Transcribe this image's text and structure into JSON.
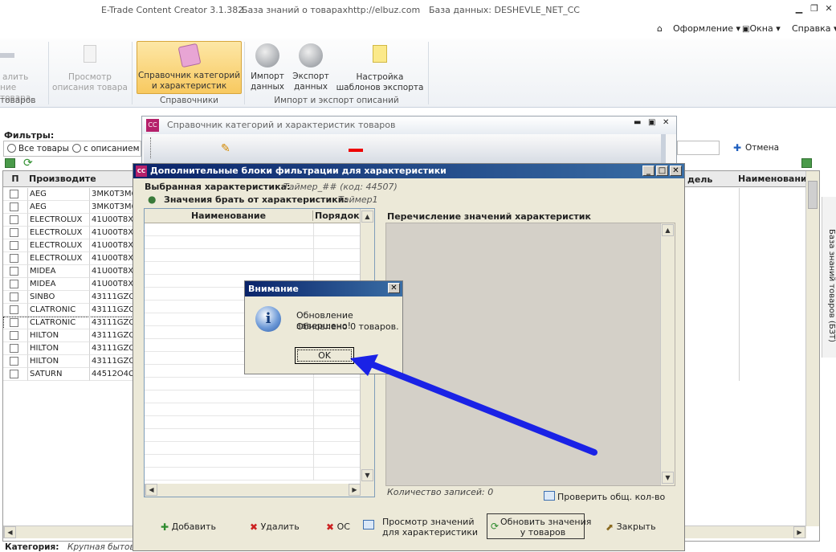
{
  "window": {
    "app_title": "E-Trade Content Creator 3.1.382",
    "kb_title": "База знаний о товарах",
    "site": "http://elbuz.com",
    "db_title": "База данных: DESHEVLE_NET_CC"
  },
  "menu": {
    "theme": "Оформление",
    "windows": "Окна",
    "help": "Справка"
  },
  "ribbon": {
    "partial_btn_line1": "алить",
    "partial_btn_line2": "ние товара",
    "partial_group": "товаров",
    "preview_line1": "Просмотр",
    "preview_line2": "описания товара",
    "categories_line1": "Справочник категорий",
    "categories_line2": "и характеристик",
    "group_refs": "Справочники",
    "import_line1": "Импорт",
    "import_line2": "данных",
    "export_line1": "Экспорт",
    "export_line2": "данных",
    "templates_line1": "Настройка",
    "templates_line2": "шаблонов экспорта",
    "group_io": "Импорт и экспорт описаний"
  },
  "main": {
    "filters_label": "Фильтры:",
    "radio_all": "Все товары",
    "radio_with_desc": "с описанием",
    "cancel_label": "Отмена",
    "col_p": "П",
    "col_maker": "Производите",
    "col_model_partial": "дель",
    "col_name": "Наименование",
    "side_tab": "База знаний товаров (БЗТ)",
    "category_label": "Категория:",
    "category_value": "Крупная бытов",
    "rows": [
      {
        "maker": "AEG",
        "code": "3МК0Т3М6"
      },
      {
        "maker": "AEG",
        "code": "3МК0Т3М6"
      },
      {
        "maker": "ELECTROLUX",
        "code": "41U00T8X"
      },
      {
        "maker": "ELECTROLUX",
        "code": "41U00T8X"
      },
      {
        "maker": "ELECTROLUX",
        "code": "41U00T8X"
      },
      {
        "maker": "ELECTROLUX",
        "code": "41U00T8X"
      },
      {
        "maker": "MIDEA",
        "code": "41U00T8X"
      },
      {
        "maker": "MIDEA",
        "code": "41U00T8X"
      },
      {
        "maker": "SINBO",
        "code": "43111GZQ"
      },
      {
        "maker": "CLATRONIC",
        "code": "43111GZQ"
      },
      {
        "maker": "CLATRONIC",
        "code": "43111GZQ"
      },
      {
        "maker": "HILTON",
        "code": "43111GZQ"
      },
      {
        "maker": "HILTON",
        "code": "43111GZQ"
      },
      {
        "maker": "HILTON",
        "code": "43111GZQ"
      },
      {
        "maker": "SATURN",
        "code": "44512O4C"
      }
    ]
  },
  "catwin": {
    "title": "Справочник категорий и характеристик товаров"
  },
  "filterwin": {
    "title": "Дополнительные блоки фильтрации для характеристики",
    "selected_label": "Выбранная характеристика:",
    "selected_value": "Таймер_## (код: 44507)",
    "source_label": "Значения брать от характеристики:",
    "source_value": "Таймер1",
    "col_name": "Наименование",
    "col_order": "Порядок",
    "enum_title": "Перечисление значений характеристик",
    "records": "Количество записей: 0",
    "check_total": "Проверить общ. кол-во",
    "btn_add": "Добавить",
    "btn_delete": "Удалить",
    "btn_os": "ОС",
    "btn_view_line1": "Просмотр значений",
    "btn_view_line2": "для характеристики",
    "btn_update_line1": "Обновить значения",
    "btn_update_line2": "у товаров",
    "btn_close": "Закрыть"
  },
  "dialog": {
    "title": "Внимание",
    "line1": "Обновление завершено!",
    "line2": "Обновлено 0 товаров.",
    "ok": "OK"
  },
  "colors": {
    "arrow": "#1a22e6",
    "caption_dark": "#0a246a",
    "caption_light": "#3a6ea5",
    "ribbon_active": "#f8c960"
  }
}
